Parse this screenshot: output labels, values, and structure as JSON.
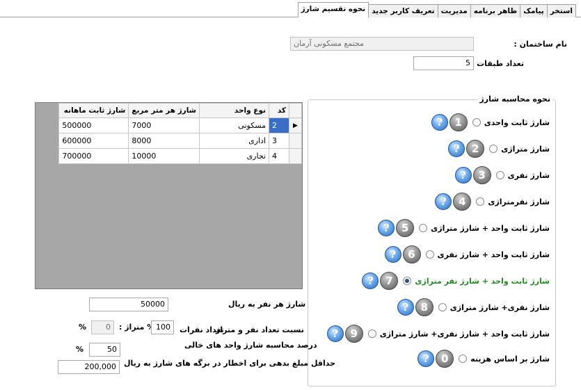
{
  "tabs": [
    {
      "label": "نحوه تقسیم شارژ",
      "active": true
    },
    {
      "label": "تعریف کاربر جدید",
      "active": false
    },
    {
      "label": "مدیریت",
      "active": false
    },
    {
      "label": "ظاهر برنامه",
      "active": false
    },
    {
      "label": "پیامک",
      "active": false
    },
    {
      "label": "استخر",
      "active": false
    }
  ],
  "building": {
    "name_label": "نام ساختمان :",
    "name_value": "مجتمع مسکونی آرمان",
    "floors_label": "تعداد طبقات :",
    "floors_value": "5"
  },
  "grid": {
    "columns": [
      "کد",
      "نوع واحد",
      "شارژ هر متر مربع",
      "شارژ ثابت ماهانه"
    ],
    "rows": [
      {
        "code": "2",
        "type": "مسکونی",
        "per_meter": "7000",
        "fixed": "500000",
        "selected": true
      },
      {
        "code": "3",
        "type": "اداری",
        "per_meter": "8000",
        "fixed": "600000",
        "selected": false
      },
      {
        "code": "4",
        "type": "تجاری",
        "per_meter": "10000",
        "fixed": "700000",
        "selected": false
      }
    ],
    "current_row_marker": "▶"
  },
  "charge_method": {
    "title": "نحوه محاسبه شارژ",
    "options": [
      {
        "num": "1",
        "label": "شارژ ثابت واحدی",
        "selected": false,
        "highlight": false
      },
      {
        "num": "2",
        "label": "شارژ متراژی",
        "selected": false,
        "highlight": false
      },
      {
        "num": "3",
        "label": "شارژ نفری",
        "selected": false,
        "highlight": false
      },
      {
        "num": "4",
        "label": "شارژ نفرمتراژی",
        "selected": false,
        "highlight": false
      },
      {
        "num": "5",
        "label": "شارژ ثابت واحد + شارژ متراژی",
        "selected": false,
        "highlight": false
      },
      {
        "num": "6",
        "label": "شارژ ثابت واحد + شارژ نفری",
        "selected": false,
        "highlight": false
      },
      {
        "num": "7",
        "label": "شارژ ثابت واحد + شارژ نفر متراژی",
        "selected": true,
        "highlight": true
      },
      {
        "num": "8",
        "label": "شارژ نفری+ شارژ متراژی",
        "selected": false,
        "highlight": false
      },
      {
        "num": "9",
        "label": "شارژ ثابت واحد +  شارژ نفری+ شارژ متراژی",
        "selected": false,
        "highlight": false
      },
      {
        "num": "0",
        "label": "شارژ بر اساس هزینه",
        "selected": false,
        "highlight": false
      }
    ],
    "help_glyph": "?",
    "highlight_color": "#1f8a1f"
  },
  "settings": {
    "per_person_label": "شارژ هر نفر به ریال",
    "per_person_value": "50000",
    "ratio_label": "نسبت تعداد نفر و متراژ",
    "persons_label": "تعداد نفرات",
    "persons_value": "100",
    "metraj_label": "% متراژ :",
    "metraj_value": "0",
    "percent_sign": "%",
    "empty_units_label": "درصد محاسبه شارژ واحد های خالی",
    "empty_units_value": "50",
    "min_amount_label": "حداقل مبلغ بدهی برای اخطار در برگه های شارژ به ریال",
    "min_amount_value": "200,000"
  }
}
